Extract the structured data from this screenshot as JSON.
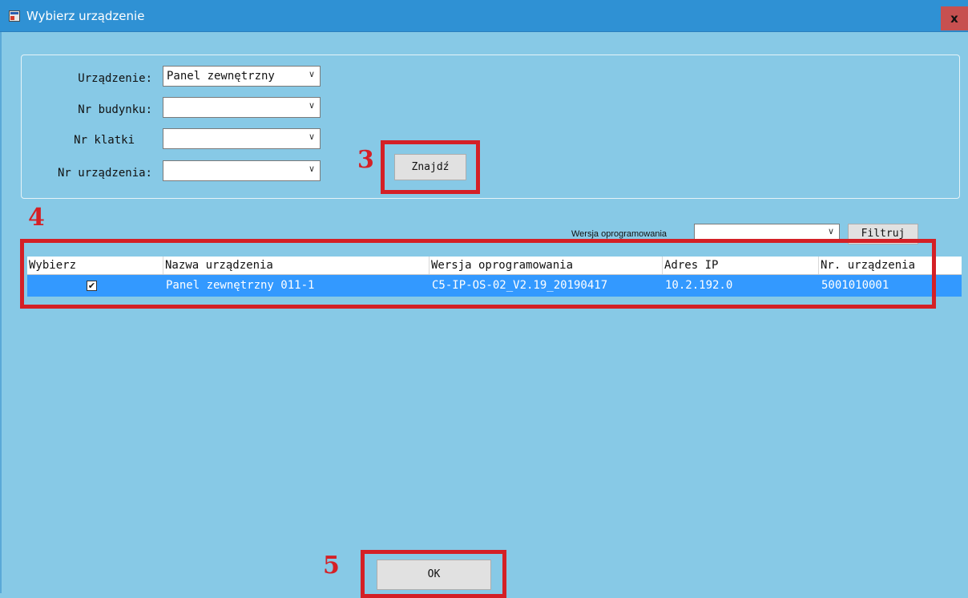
{
  "window": {
    "title": "Wybierz urządzenie",
    "close_label": "x"
  },
  "form": {
    "device_label": "Urządzenie:",
    "device_value": "Panel zewnętrzny",
    "building_label": "Nr budynku:",
    "building_value": "",
    "cage_label": "Nr klatki",
    "cage_value": "",
    "device_no_label": "Nr urządzenia:",
    "device_no_value": "",
    "find_button": "Znajdź"
  },
  "filter": {
    "version_label": "Wersja oprogramowania",
    "version_value": "",
    "filter_button": "Filtruj"
  },
  "table": {
    "columns": [
      "Wybierz",
      "Nazwa urządzenia",
      "Wersja oprogramowania",
      "Adres IP",
      "Nr. urządzenia"
    ],
    "rows": [
      {
        "selected": true,
        "checked_glyph": "✔",
        "name": "Panel zewnętrzny 011-1",
        "version": "C5-IP-OS-02_V2.19_20190417",
        "ip": "10.2.192.0",
        "device_no": "5001010001"
      }
    ]
  },
  "ok_button": "OK",
  "annotations": {
    "step3": "3",
    "step4": "4",
    "step5": "5"
  },
  "colors": {
    "background": "#87c9e6",
    "titlebar": "#2f91d4",
    "selection": "#3399ff",
    "annotation_red": "#d42026",
    "close_button": "#c75050"
  },
  "icons": {
    "window": "app-window-icon",
    "close": "close-icon",
    "dropdown": "chevron-down-icon",
    "checkbox": "checkbox-checked-icon"
  }
}
